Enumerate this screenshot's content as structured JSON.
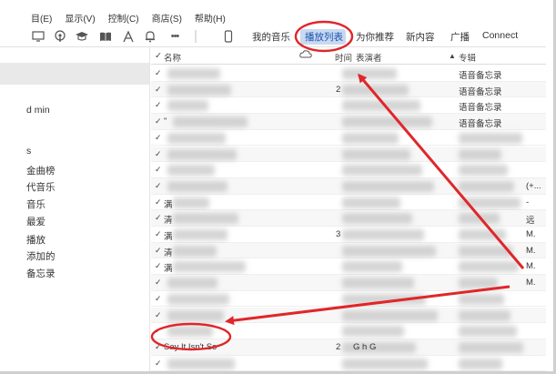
{
  "menubar": {
    "items": [
      "目(E)",
      "显示(V)",
      "控制(C)",
      "商店(S)",
      "帮助(H)"
    ]
  },
  "toolbar": {
    "icons": [
      "monitor-icon",
      "podcast-icon",
      "graduation-cap-icon",
      "books-icon",
      "apps-icon",
      "bell-icon",
      "more-icon",
      "device-icon"
    ],
    "more_glyph": "•••",
    "tabs": [
      "我的音乐",
      "播放列表",
      "为你推荐",
      "新内容",
      "广播",
      "Connect"
    ],
    "active_tab": "播放列表"
  },
  "sidebar": {
    "items": [
      "d min",
      "s",
      "金曲榜",
      "代音乐",
      "音乐",
      "最爱",
      "播放",
      "添加的",
      "备忘录"
    ]
  },
  "table": {
    "headers": {
      "name": "名称",
      "time": "时间",
      "artist": "表演者",
      "album": "专辑"
    },
    "checkmark": "✓",
    "rows": [
      {
        "name": "",
        "time": "",
        "album": "语音备忘录"
      },
      {
        "name": "",
        "time": "2",
        "album": "语音备忘录"
      },
      {
        "name": "",
        "time": "",
        "album": "语音备忘录"
      },
      {
        "name": "\"",
        "time": "",
        "album": "语音备忘录"
      },
      {
        "name": "",
        "time": "",
        "album": ""
      },
      {
        "name": "",
        "time": "",
        "album": ""
      },
      {
        "name": "",
        "time": "",
        "album": ""
      },
      {
        "name": "",
        "time": "",
        "album": "(+..."
      },
      {
        "name": "满",
        "time": "",
        "album": "-"
      },
      {
        "name": "清",
        "time": "",
        "album": "远"
      },
      {
        "name": "满",
        "time": "3",
        "album": "M."
      },
      {
        "name": "清",
        "time": "",
        "album": "M."
      },
      {
        "name": "满",
        "time": "",
        "album": "M."
      },
      {
        "name": "",
        "time": "",
        "album": "M."
      },
      {
        "name": "",
        "time": "",
        "album": ""
      },
      {
        "name": "",
        "time": "",
        "album": ""
      },
      {
        "name": "",
        "time": "",
        "album": ""
      },
      {
        "name": "Say It Isn't So",
        "time": "2",
        "artist": "G     h G",
        "album": ""
      },
      {
        "name": "",
        "time": "",
        "album": ""
      }
    ]
  },
  "annotation_colors": {
    "circle": "#e0262a",
    "arrow": "#e0262a"
  }
}
